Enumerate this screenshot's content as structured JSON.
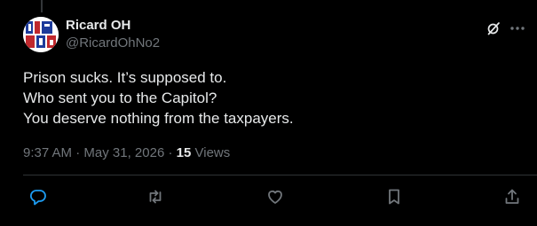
{
  "post": {
    "author": {
      "display_name": "Ricard OH",
      "handle": "@RicardOhNo2"
    },
    "text_lines": [
      "Prison sucks. It’s supposed to.",
      "Who sent you to the Capitol?",
      "You deserve nothing from the taxpayers."
    ],
    "time": "9:37 AM",
    "separator": "·",
    "date": "May 31, 2026",
    "views_count": "15",
    "views_label": "Views"
  },
  "actions": {
    "reply": "reply-icon",
    "repost": "repost-icon",
    "like": "heart-icon",
    "bookmark": "bookmark-icon",
    "share": "share-icon"
  },
  "header_icons": {
    "grok": "grok-icon",
    "more": "more-icon"
  },
  "colors": {
    "background": "#000000",
    "primary_text": "#e7e9ea",
    "secondary_text": "#71767b",
    "divider": "#2f3336"
  }
}
